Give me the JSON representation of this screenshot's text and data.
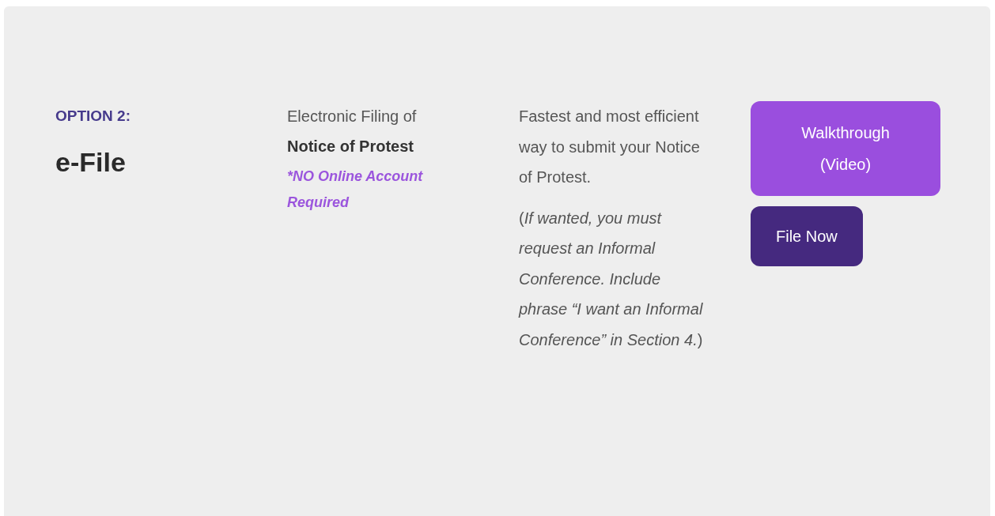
{
  "option": {
    "label": "OPTION 2:",
    "title": "e-File"
  },
  "method": {
    "intro": "Electronic Filing of",
    "name": "Notice of Protest",
    "note": "*NO Online Account Required"
  },
  "details": {
    "summary": "Fastest and most efficient way to submit your Notice of Protest.",
    "remark": "(*If wanted, you must request an Informal Conference. Include phrase “I want an Informal Conference” in Section 4.*)"
  },
  "buttons": [
    {
      "label": "Walkthrough (Video)",
      "kind": "primary"
    },
    {
      "label": "File Now",
      "kind": "secondary"
    }
  ]
}
